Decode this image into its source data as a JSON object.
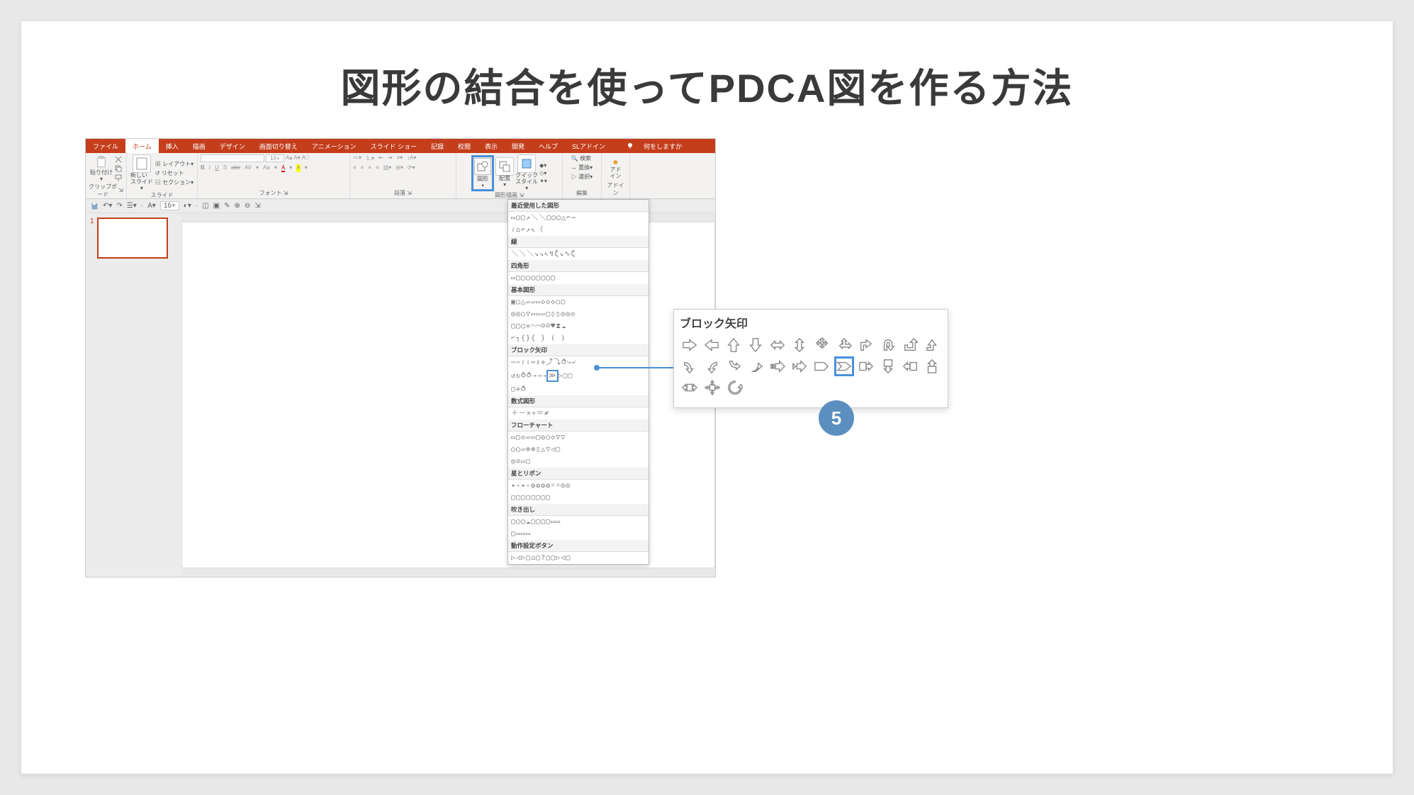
{
  "title": "図形の結合を使ってPDCA図を作る方法",
  "ribbon": {
    "tabs": [
      "ファイル",
      "ホーム",
      "挿入",
      "描画",
      "デザイン",
      "画面切り替え",
      "アニメーション",
      "スライド ショー",
      "記録",
      "校閲",
      "表示",
      "開発",
      "ヘルプ",
      "SLアドイン"
    ],
    "active_tab": "ホーム",
    "tell_me": "何をしますか",
    "groups": {
      "clipboard": {
        "label": "クリップボード",
        "paste": "貼り付け"
      },
      "slides": {
        "label": "スライド",
        "new_slide": "新しい\nスライド",
        "layout": "レイアウト",
        "reset": "リセット",
        "section": "セクション"
      },
      "font": {
        "label": "フォント",
        "size_placeholder": "16+",
        "bold": "B",
        "italic": "I",
        "underline": "U",
        "strike": "S",
        "strike2": "abc",
        "sub": "AV",
        "clear": "Aa",
        "a_big": "A",
        "a_big2": "A"
      },
      "paragraph": {
        "label": "段落"
      },
      "drawing": {
        "label": "図形描画",
        "shapes": "図形",
        "arrange": "配置",
        "quick": "クイック\nスタイル"
      },
      "editing": {
        "label": "編集",
        "find": "検索",
        "replace": "置換",
        "select": "選択"
      },
      "addin": {
        "label": "アドイン",
        "btn": "アド\nイン"
      }
    }
  },
  "qat": {
    "font_size": "16+"
  },
  "thumb_index": "1",
  "shapes_dropdown": {
    "categories": [
      {
        "name": "最近使用した図形",
        "rows": [
          "▭◯▢↗＼＼▢◯◯△⌐⇨",
          "⇩⌂↶↗↖（"
        ]
      },
      {
        "name": "線",
        "rows": [
          "＼＼＼↘↘↖↯ζ↘∿ζ"
        ]
      },
      {
        "name": "四角形",
        "rows": [
          "▭▢▢◯◯▢▢▢▢"
        ]
      },
      {
        "name": "基本図形",
        "rows": [
          "▣◯△▱▱▭◇◇◇○◯",
          "◎◎○▽▭▭▱▢▯▯◎◎◇",
          "▢▢◯✕⌒⌒☺☹♥⧗☁",
          "⌐┐{}{ } ( )"
        ]
      },
      {
        "name": "ブロック矢印",
        "rows": [
          "⇨⇦⇧⇩⇔⇕✛⤴⤵⥀⤷⤶",
          "↺↻⥁⥀⇢⇢⇢[≫]▷▢▢",
          "▢✛⥀"
        ]
      },
      {
        "name": "数式図形",
        "rows": [
          "＋－×÷＝≠"
        ]
      },
      {
        "name": "フローチャート",
        "rows": [
          "▭▢◇▱▭▢◎○◇▽▽",
          "○◯▱⊗⊕▯△▽◁▢",
          "◎⊝▭▢"
        ]
      },
      {
        "name": "星とリボン",
        "rows": [
          "✦✧✦✧✪✪✪✪☼☼◎◎",
          "▢▢▢▢▢▢▢▢"
        ]
      },
      {
        "name": "吹き出し",
        "rows": [
          "▢◯◯☁▢▢▢▢▭▭",
          "▢▭▭▭"
        ]
      },
      {
        "name": "動作設定ボタン",
        "rows": [
          "▷◁▷▢⌂▢?▢▢▷◁▢"
        ]
      }
    ]
  },
  "popup": {
    "title": "ブロック矢印",
    "highlight_svg_title": "chevron-arrow"
  },
  "step": "5"
}
